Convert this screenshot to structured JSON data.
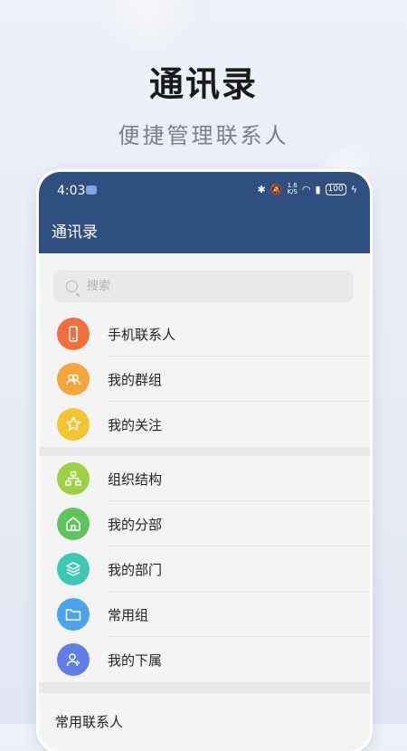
{
  "hero": {
    "title": "通讯录",
    "subtitle": "便捷管理联系人"
  },
  "status_bar": {
    "time": "4:03",
    "speed_value": "1.6",
    "speed_unit": "K/S",
    "battery": "100"
  },
  "app_bar": {
    "title": "通讯录"
  },
  "search": {
    "placeholder": "搜索"
  },
  "groups": [
    [
      {
        "label": "手机联系人",
        "icon": "phone-icon",
        "color": "#f26f3c"
      },
      {
        "label": "我的群组",
        "icon": "group-icon",
        "color": "#f4a63b"
      },
      {
        "label": "我的关注",
        "icon": "star-icon",
        "color": "#f5c431"
      }
    ],
    [
      {
        "label": "组织结构",
        "icon": "org-chart-icon",
        "color": "#9bd142"
      },
      {
        "label": "我的分部",
        "icon": "home-icon",
        "color": "#5ec45b"
      },
      {
        "label": "我的部门",
        "icon": "layers-icon",
        "color": "#3fc7b5"
      },
      {
        "label": "常用组",
        "icon": "folder-icon",
        "color": "#4aa3ef"
      },
      {
        "label": "我的下属",
        "icon": "subordinates-icon",
        "color": "#5f7fe8"
      }
    ]
  ],
  "frequent": {
    "title": "常用联系人"
  }
}
